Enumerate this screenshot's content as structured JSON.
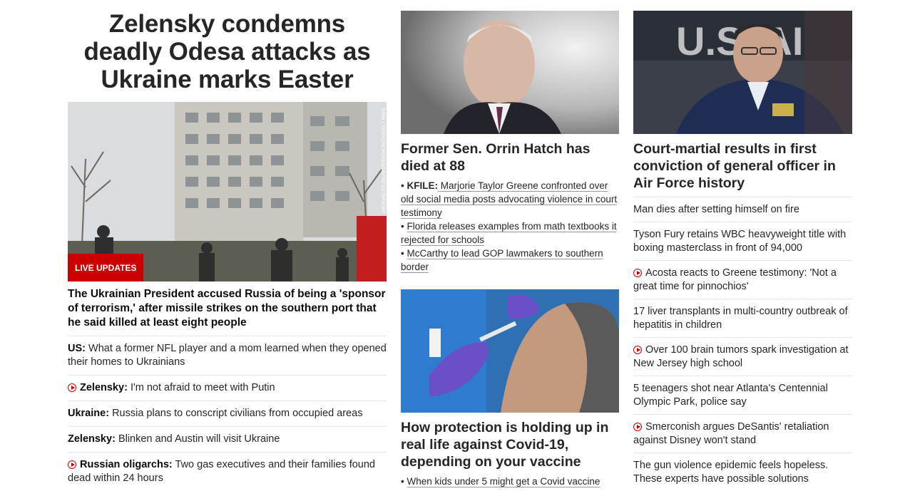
{
  "col1": {
    "headline": "Zelensky condemns deadly Odesa attacks as Ukraine marks Easter",
    "badge": "LIVE UPDATES",
    "photo_credit": "NINA LYASHONOK/ABACAPRESS/SIPA/AP",
    "summary": "The Ukrainian President accused Russia of being a 'sponsor of terrorism,' after missile strikes on the southern port that he said killed at least eight people",
    "items": [
      {
        "label": "US:",
        "text": "What a former NFL player and a mom learned when they opened their homes to Ukrainians",
        "video": false
      },
      {
        "label": "Zelensky:",
        "text": "I'm not afraid to meet with Putin",
        "video": true
      },
      {
        "label": "Ukraine:",
        "text": "Russia plans to conscript civilians from occupied areas",
        "video": false
      },
      {
        "label": "Zelensky:",
        "text": "Blinken and Austin will visit Ukraine",
        "video": false
      },
      {
        "label": "Russian oligarchs:",
        "text": "Two gas executives and their families found dead within 24 hours",
        "video": true
      }
    ]
  },
  "col2": {
    "story1": {
      "title": "Former Sen. Orrin Hatch has died at 88",
      "bullets": [
        {
          "label": "KFILE:",
          "text": "Marjorie Taylor Greene confronted over old social media posts advocating violence in court testimony"
        },
        {
          "label": "",
          "text": "Florida releases examples from math textbooks it rejected for schools"
        },
        {
          "label": "",
          "text": "McCarthy to lead GOP lawmakers to southern border"
        }
      ]
    },
    "story2": {
      "title": "How protection is holding up in real life against Covid-19, depending on your vaccine",
      "bullets": [
        {
          "label": "",
          "text": "When kids under 5 might get a Covid vaccine"
        }
      ]
    }
  },
  "col3": {
    "title": "Court-martial results in first conviction of general officer in Air Force history",
    "items": [
      {
        "text": "Man dies after setting himself on fire",
        "video": false
      },
      {
        "text": "Tyson Fury retains WBC heavyweight title with boxing masterclass in front of 94,000",
        "video": false
      },
      {
        "text": "Acosta reacts to Greene testimony: 'Not a great time for pinnochios'",
        "video": true
      },
      {
        "text": "17 liver transplants in multi-country outbreak of hepatitis in children",
        "video": false
      },
      {
        "text": "Over 100 brain tumors spark investigation at New Jersey high school",
        "video": true
      },
      {
        "text": "5 teenagers shot near Atlanta's Centennial Olympic Park, police say",
        "video": false
      },
      {
        "text": "Smerconish argues DeSantis' retaliation against Disney won't stand",
        "video": true
      },
      {
        "text": "The gun violence epidemic feels hopeless. These experts have possible solutions",
        "video": false
      }
    ]
  },
  "colors": {
    "accent": "#cc0000",
    "text": "#262626",
    "divider": "#e6e6e6"
  }
}
